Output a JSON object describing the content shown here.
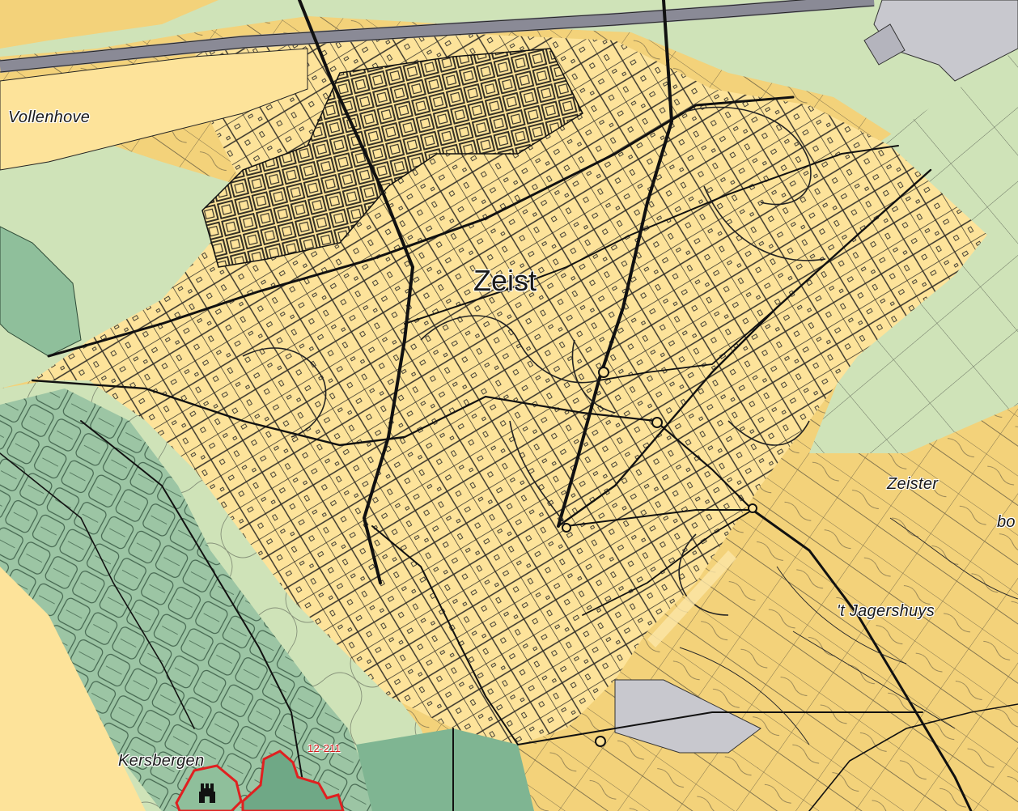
{
  "map": {
    "place_labels": {
      "zeist": "Zeist",
      "vollenhove": "Vollenhove",
      "zeister": "Zeister",
      "bo": "bo",
      "jagershuys": "'t Jagershuys",
      "kersbergen": "Kersbergen"
    },
    "monument_code": "12-211",
    "colors": {
      "built_up": "#fde39a",
      "forest_dark": "#8fbf9b",
      "grassland": "#cfe3b8",
      "heath": "#f3d27a",
      "industrial": "#c8c8ce",
      "roads": "#111111",
      "railway": "#8a8a96",
      "monument_border": "#e02020"
    },
    "icons": [
      "castle-icon"
    ]
  }
}
